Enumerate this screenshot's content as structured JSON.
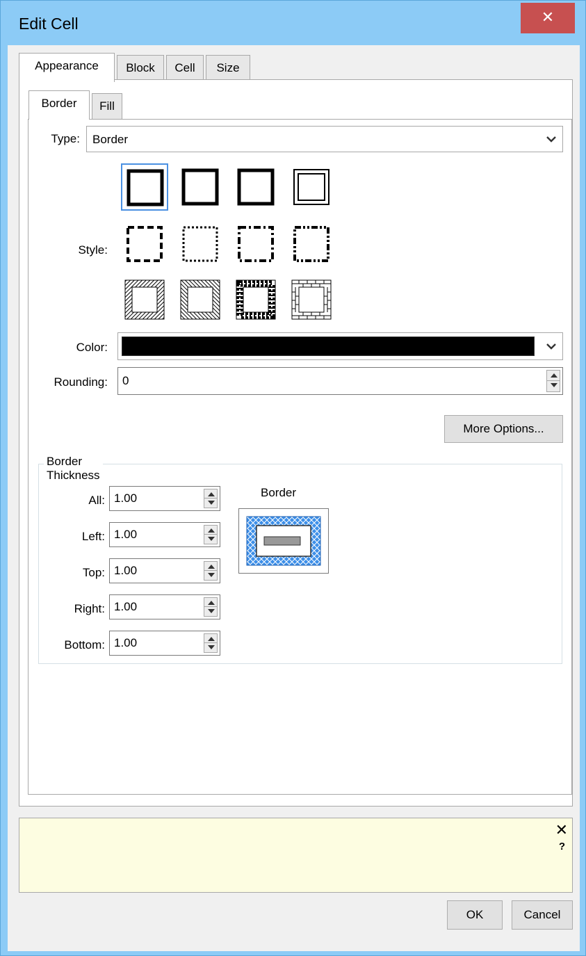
{
  "window": {
    "title": "Edit Cell",
    "close_glyph": "✕"
  },
  "tabs": [
    {
      "label": "Appearance",
      "active": true
    },
    {
      "label": "Block",
      "active": false
    },
    {
      "label": "Cell",
      "active": false
    },
    {
      "label": "Size",
      "active": false
    }
  ],
  "subtabs": [
    {
      "label": "Border",
      "active": true
    },
    {
      "label": "Fill",
      "active": false
    }
  ],
  "type": {
    "label": "Type:",
    "value": "Border"
  },
  "style": {
    "label": "Style:",
    "options": [
      "solid-thick",
      "solid-medium",
      "solid",
      "double",
      "dashed",
      "dotted",
      "dash-dot",
      "dash-dot-dot",
      "hatched-left",
      "hatched-right",
      "beaded",
      "brick"
    ],
    "selected": "solid-thick"
  },
  "color": {
    "label": "Color:",
    "value": "#000000"
  },
  "rounding": {
    "label": "Rounding:",
    "value": "0"
  },
  "more_options_label": "More Options...",
  "border_thickness": {
    "title": "Border Thickness",
    "fields": [
      {
        "label": "All:",
        "value": "1.00"
      },
      {
        "label": "Left:",
        "value": "1.00"
      },
      {
        "label": "Top:",
        "value": "1.00"
      },
      {
        "label": "Right:",
        "value": "1.00"
      },
      {
        "label": "Bottom:",
        "value": "1.00"
      }
    ],
    "preview_label": "Border",
    "preview_color": "#3d8fe8"
  },
  "infobar": {
    "close_glyph": "✕",
    "help_glyph": "?"
  },
  "buttons": {
    "ok": "OK",
    "cancel": "Cancel"
  }
}
